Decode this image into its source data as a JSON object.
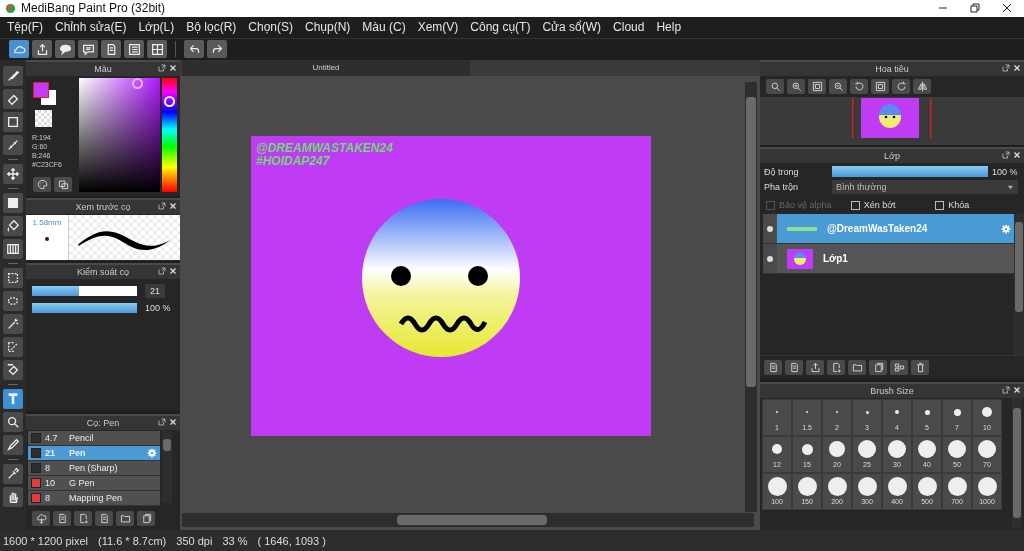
{
  "window": {
    "title": "MediBang Paint Pro (32bit)"
  },
  "menu": [
    "Tệp(F)",
    "Chỉnh sửa(E)",
    "Lớp(L)",
    "Bộ lọc(R)",
    "Chọn(S)",
    "Chụp(N)",
    "Màu (C)",
    "Xem(V)",
    "Công cụ(T)",
    "Cửa sổ(W)",
    "Cloud",
    "Help"
  ],
  "toolbar": [
    {
      "kind": "cloud",
      "selected": true
    },
    {
      "kind": "upload",
      "selected": false
    },
    {
      "kind": "speech-bubble",
      "selected": false
    },
    {
      "kind": "comment",
      "selected": false
    },
    {
      "kind": "page",
      "selected": false
    },
    {
      "kind": "list",
      "selected": false
    },
    {
      "kind": "grid",
      "selected": false
    },
    {
      "kind": "undo",
      "selected": false
    },
    {
      "kind": "redo",
      "selected": false
    }
  ],
  "tools": [
    {
      "kind": "brush",
      "selected": false
    },
    {
      "kind": "eraser",
      "selected": false
    },
    {
      "kind": "square",
      "selected": false
    },
    {
      "kind": "ruler",
      "selected": false
    },
    {
      "kind": "move",
      "selected": false
    },
    {
      "kind": "filled-square",
      "selected": false
    },
    {
      "kind": "bucket",
      "selected": false
    },
    {
      "kind": "gradient",
      "selected": false
    },
    {
      "kind": "selection",
      "selected": false
    },
    {
      "kind": "lasso",
      "selected": false
    },
    {
      "kind": "wand",
      "selected": false
    },
    {
      "kind": "selection-pen",
      "selected": false
    },
    {
      "kind": "selection-eraser",
      "selected": false
    },
    {
      "kind": "text",
      "selected": true
    },
    {
      "kind": "object-select",
      "selected": false
    },
    {
      "kind": "pen",
      "selected": false
    },
    {
      "kind": "dropper",
      "selected": false
    },
    {
      "kind": "hand",
      "selected": false
    }
  ],
  "color_panel": {
    "title": "Màu",
    "readouts": [
      "R:194",
      "G:60",
      "B:246",
      "#C23CF6"
    ]
  },
  "brush_preview": {
    "title": "Xem trước cọ",
    "size": "1.58mm"
  },
  "brush_control": {
    "title": "Kiểm soát cọ",
    "size": {
      "level": 0.45,
      "value": "21"
    },
    "opacity": {
      "level": 1,
      "reading": "100 %"
    }
  },
  "brush_list": {
    "title": "Cọ: Pen",
    "items": [
      {
        "size": "4.7",
        "name": "Pencil",
        "color": "#2e2e2e",
        "selected": false
      },
      {
        "size": "21",
        "name": "Pen",
        "color": "#2e2e2e",
        "selected": true
      },
      {
        "size": "8",
        "name": "Pen (Sharp)",
        "color": "#2e2e2e",
        "selected": false
      },
      {
        "size": "10",
        "name": "G Pen",
        "color": "#e83a3a",
        "selected": false
      },
      {
        "size": "8",
        "name": "Mapping Pen",
        "color": "#e83a3a",
        "selected": false
      }
    ]
  },
  "document": {
    "tab": "Untitled",
    "texts": [
      "@DREAMWASTAKEN24",
      "#HOIDAP247"
    ]
  },
  "navigator": {
    "title": "Hoa tiêu"
  },
  "layers": {
    "title": "Lớp",
    "opacity_label": "Độ trong",
    "opacity": {
      "level": 1,
      "reading": "100 %"
    },
    "blend_label": "Pha trộn",
    "blend": "Bình thường",
    "options": [
      {
        "label": "Bảo vệ alpha",
        "checked": false,
        "disabled": true
      },
      {
        "label": "Xén bớt",
        "checked": false,
        "disabled": false
      },
      {
        "label": "Khóa",
        "checked": false,
        "disabled": false
      }
    ],
    "items": [
      {
        "name": "@DreamWasTaken24",
        "kind": "text",
        "selected": true,
        "visible": true
      },
      {
        "name": "Lớp1",
        "kind": "image",
        "selected": false,
        "visible": true
      }
    ]
  },
  "brush_size": {
    "title": "Brush Size",
    "sizes": [
      "1",
      "1.5",
      "2",
      "3",
      "4",
      "5",
      "7",
      "10",
      "12",
      "15",
      "20",
      "25",
      "30",
      "40",
      "50",
      "70",
      "100",
      "150",
      "200",
      "300",
      "400",
      "500",
      "700",
      "1000"
    ]
  },
  "status_bar": [
    "1600 * 1200 pixel",
    "(11.6 * 8.7cm)",
    "350 dpi",
    "33 %",
    "( 1646, 1093 )"
  ]
}
